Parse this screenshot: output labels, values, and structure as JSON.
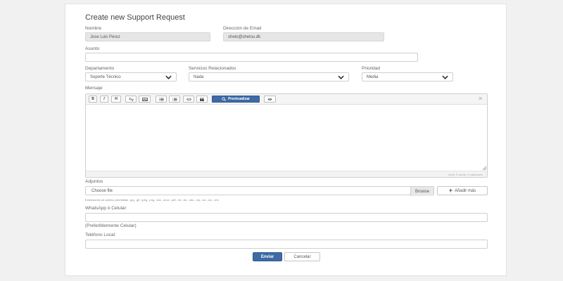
{
  "form": {
    "title": "Create new Support Request",
    "nombre": {
      "label": "Nombre",
      "value": "Jose Luis Perez"
    },
    "email": {
      "label": "Dirección de Email",
      "value": "shelo@shelou.dk"
    },
    "asunto": {
      "label": "Asunto",
      "value": ""
    },
    "departamento": {
      "label": "Departamento",
      "value": "Soporte Técnico"
    },
    "servicios": {
      "label": "Servicios Relacionados",
      "value": "Nada"
    },
    "prioridad": {
      "label": "Prioridad",
      "value": "Media"
    },
    "mensaje": {
      "label": "Mensaje",
      "toolbar": {
        "bold": "B",
        "italic": "I",
        "heading": "H",
        "preview_label": "Previsualizar"
      },
      "status": "lines: 0   words: 0   markdown"
    },
    "adjuntos": {
      "label": "Adjuntos",
      "placeholder": "Choose file",
      "browse": "Browse",
      "add_more": "Añadir más",
      "help": "Extensiones de archivo permitidas: .jpg, .gif, .jpeg, .png, .doc, .docx, .pdf, .txt, .xls, .xlsx, .zip, .rar, .csv, .xml"
    },
    "whatsapp": {
      "label": "WhatsApp ó Celular:",
      "value": "",
      "help": "(Preferiblemente Celular)"
    },
    "telefono": {
      "label": "Teléfono Local:",
      "value": ""
    },
    "submit": "Enviar",
    "cancel": "Cancelar"
  },
  "colors": {
    "primary": "#3e6aa5",
    "readonly_bg": "#e6e6e6",
    "page_bg": "#f1f1f1"
  }
}
